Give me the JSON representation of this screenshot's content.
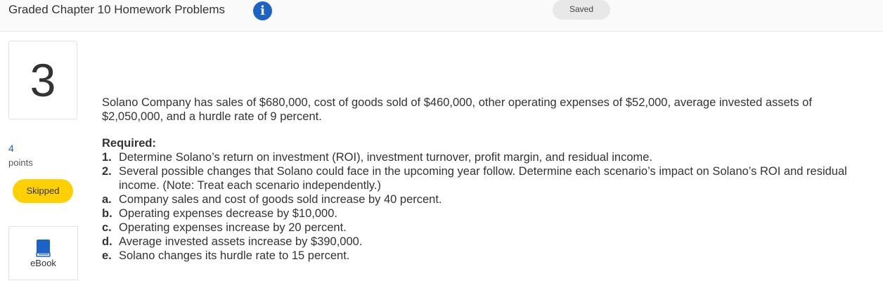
{
  "header": {
    "title": "Graded Chapter 10 Homework Problems",
    "info_icon": "info-icon",
    "status": "Saved"
  },
  "sidebar": {
    "question_number": "3",
    "points_value": "4",
    "points_label": "points",
    "status_badge": "Skipped",
    "ebook_label": "eBook",
    "ebook_icon": "book-icon"
  },
  "question": {
    "intro": "Solano Company has sales of $680,000, cost of goods sold of $460,000, other operating expenses of $52,000, average invested assets of $2,050,000, and a hurdle rate of 9 percent.",
    "required_heading": "Required:",
    "items": [
      {
        "marker": "1.",
        "text": "Determine Solano’s return on investment (ROI), investment turnover, profit margin, and residual income."
      },
      {
        "marker": "2.",
        "text": "Several possible changes that Solano could face in the upcoming year follow. Determine each scenario’s impact on Solano’s ROI and residual income. (Note: Treat each scenario independently.)"
      },
      {
        "marker": "a.",
        "text": "Company sales and cost of goods sold increase by 40 percent."
      },
      {
        "marker": "b.",
        "text": "Operating expenses decrease by $10,000."
      },
      {
        "marker": "c.",
        "text": "Operating expenses increase by 20 percent."
      },
      {
        "marker": "d.",
        "text": "Average invested assets increase by $390,000."
      },
      {
        "marker": "e.",
        "text": "Solano changes its hurdle rate to 15 percent."
      }
    ]
  },
  "colors": {
    "accent_blue": "#1d63c5",
    "skipped_yellow": "#ffd000",
    "saved_gray": "#e8e8e8"
  }
}
